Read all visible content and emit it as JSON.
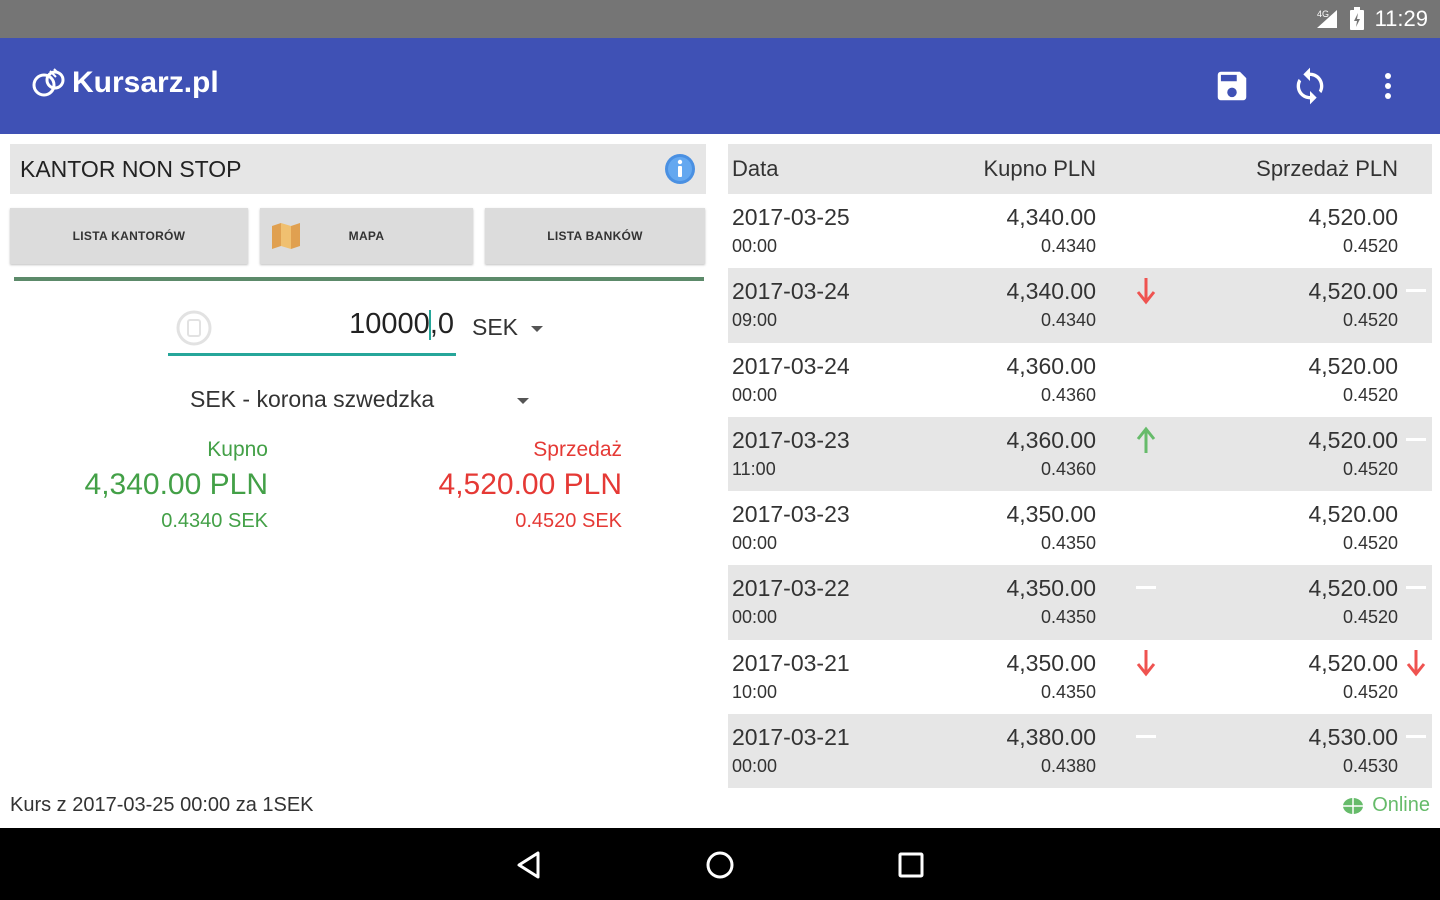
{
  "status_bar": {
    "time": "11:29"
  },
  "app_bar": {
    "title": "Kursarz.pl",
    "actions": [
      "save-icon",
      "refresh-icon",
      "more-vert-icon"
    ],
    "color": "#3f51b5"
  },
  "kantor": {
    "name": "KANTOR NON STOP"
  },
  "buttons": {
    "list_kantors": "LISTA KANTORÓW",
    "map": "MAPA",
    "list_banks": "LISTA BANKÓW"
  },
  "converter": {
    "amount_before_cursor": "10000",
    "amount_after_cursor": ",0",
    "currency_code": "SEK",
    "currency_name": "SEK - korona szwedzka"
  },
  "rates": {
    "buy_label": "Kupno",
    "buy_value": "4,340.00 PLN",
    "buy_rate": "0.4340 SEK",
    "sell_label": "Sprzedaż",
    "sell_value": "4,520.00 PLN",
    "sell_rate": "0.4520 SEK",
    "buy_color": "#43a047",
    "sell_color": "#e53935"
  },
  "rate_note": "Kurs z 2017-03-25 00:00 za 1SEK",
  "table": {
    "headers": {
      "date": "Data",
      "buy": "Kupno PLN",
      "sell": "Sprzedaż PLN"
    },
    "rows": [
      {
        "date": "2017-03-25",
        "time": "00:00",
        "buy": "4,340.00",
        "buy_rate": "0.4340",
        "sell": "4,520.00",
        "sell_rate": "0.4520",
        "buy_trend": "none",
        "sell_trend": "none"
      },
      {
        "date": "2017-03-24",
        "time": "09:00",
        "buy": "4,340.00",
        "buy_rate": "0.4340",
        "sell": "4,520.00",
        "sell_rate": "0.4520",
        "buy_trend": "down",
        "sell_trend": "flat"
      },
      {
        "date": "2017-03-24",
        "time": "00:00",
        "buy": "4,360.00",
        "buy_rate": "0.4360",
        "sell": "4,520.00",
        "sell_rate": "0.4520",
        "buy_trend": "none",
        "sell_trend": "none"
      },
      {
        "date": "2017-03-23",
        "time": "11:00",
        "buy": "4,360.00",
        "buy_rate": "0.4360",
        "sell": "4,520.00",
        "sell_rate": "0.4520",
        "buy_trend": "up",
        "sell_trend": "flat"
      },
      {
        "date": "2017-03-23",
        "time": "00:00",
        "buy": "4,350.00",
        "buy_rate": "0.4350",
        "sell": "4,520.00",
        "sell_rate": "0.4520",
        "buy_trend": "none",
        "sell_trend": "none"
      },
      {
        "date": "2017-03-22",
        "time": "00:00",
        "buy": "4,350.00",
        "buy_rate": "0.4350",
        "sell": "4,520.00",
        "sell_rate": "0.4520",
        "buy_trend": "flat",
        "sell_trend": "flat"
      },
      {
        "date": "2017-03-21",
        "time": "10:00",
        "buy": "4,350.00",
        "buy_rate": "0.4350",
        "sell": "4,520.00",
        "sell_rate": "0.4520",
        "buy_trend": "down",
        "sell_trend": "down"
      },
      {
        "date": "2017-03-21",
        "time": "00:00",
        "buy": "4,380.00",
        "buy_rate": "0.4380",
        "sell": "4,530.00",
        "sell_rate": "0.4530",
        "buy_trend": "flat",
        "sell_trend": "flat"
      }
    ]
  },
  "status": {
    "online": "Online"
  }
}
